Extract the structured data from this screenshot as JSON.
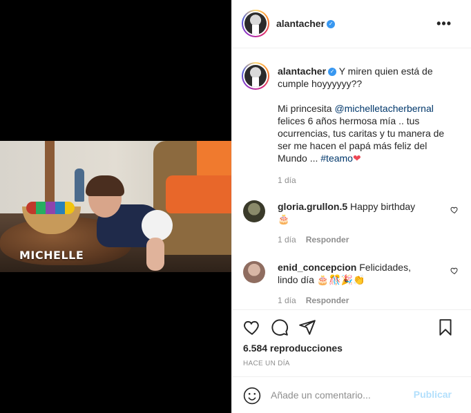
{
  "video": {
    "overlay_label": "MICHELLE"
  },
  "header": {
    "username": "alantacher",
    "more_label": "•••"
  },
  "caption": {
    "username": "alantacher",
    "line1": "Y miren quien está de cumple hoyyyyyy??",
    "line2_pre": "Mi princesita ",
    "mention": "@michelletacherbernal",
    "line2_post": " felices 6 años hermosa mía .. tus ocurrencias, tus caritas y tu manera de ser me hacen el papá más feliz del Mundo ... ",
    "hashtag": "#teamo",
    "heart": "❤",
    "time": "1 día"
  },
  "comments": [
    {
      "username": "gloria.grullon.5",
      "text": "Happy birthday",
      "emoji": "🎂",
      "time": "1 día",
      "reply": "Responder"
    },
    {
      "username": "enid_concepcion",
      "text": "Felicidades, lindo día",
      "emoji": "🎂🎊🎉👏",
      "time": "1 día",
      "reply": "Responder"
    }
  ],
  "actions": {
    "views": "6.584 reproducciones",
    "ago": "HACE UN DÍA"
  },
  "comment_box": {
    "placeholder": "Añade un comentario...",
    "publish_label": "Publicar"
  },
  "colors": {
    "link": "#00376b",
    "muted": "#8e8e8e",
    "publish_disabled": "#b2dffc",
    "verified": "#3897f0",
    "heart": "#ed4956"
  }
}
